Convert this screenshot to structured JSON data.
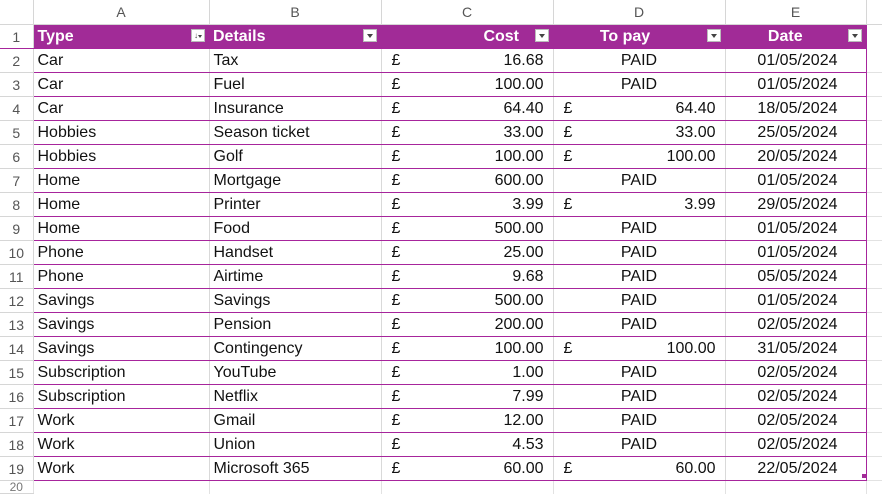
{
  "column_headers": [
    "A",
    "B",
    "C",
    "D",
    "E"
  ],
  "row_numbers": [
    "1",
    "2",
    "3",
    "4",
    "5",
    "6",
    "7",
    "8",
    "9",
    "10",
    "11",
    "12",
    "13",
    "14",
    "15",
    "16",
    "17",
    "18",
    "19",
    "20"
  ],
  "table_headers": {
    "type": "Type",
    "details": "Details",
    "cost": "Cost",
    "to_pay": "To pay",
    "date": "Date"
  },
  "currency_symbol": "£",
  "rows": [
    {
      "type": "Car",
      "details": "Tax",
      "cost": "16.68",
      "to_pay": "PAID",
      "to_pay_currency": "",
      "date": "01/05/2024"
    },
    {
      "type": "Car",
      "details": "Fuel",
      "cost": "100.00",
      "to_pay": "PAID",
      "to_pay_currency": "",
      "date": "01/05/2024"
    },
    {
      "type": "Car",
      "details": "Insurance",
      "cost": "64.40",
      "to_pay": "64.40",
      "to_pay_currency": "£",
      "date": "18/05/2024"
    },
    {
      "type": "Hobbies",
      "details": "Season ticket",
      "cost": "33.00",
      "to_pay": "33.00",
      "to_pay_currency": "£",
      "date": "25/05/2024"
    },
    {
      "type": "Hobbies",
      "details": "Golf",
      "cost": "100.00",
      "to_pay": "100.00",
      "to_pay_currency": "£",
      "date": "20/05/2024"
    },
    {
      "type": "Home",
      "details": "Mortgage",
      "cost": "600.00",
      "to_pay": "PAID",
      "to_pay_currency": "",
      "date": "01/05/2024"
    },
    {
      "type": "Home",
      "details": "Printer",
      "cost": "3.99",
      "to_pay": "3.99",
      "to_pay_currency": "£",
      "date": "29/05/2024"
    },
    {
      "type": "Home",
      "details": "Food",
      "cost": "500.00",
      "to_pay": "PAID",
      "to_pay_currency": "",
      "date": "01/05/2024"
    },
    {
      "type": "Phone",
      "details": "Handset",
      "cost": "25.00",
      "to_pay": "PAID",
      "to_pay_currency": "",
      "date": "01/05/2024"
    },
    {
      "type": "Phone",
      "details": "Airtime",
      "cost": "9.68",
      "to_pay": "PAID",
      "to_pay_currency": "",
      "date": "05/05/2024"
    },
    {
      "type": "Savings",
      "details": "Savings",
      "cost": "500.00",
      "to_pay": "PAID",
      "to_pay_currency": "",
      "date": "01/05/2024"
    },
    {
      "type": "Savings",
      "details": "Pension",
      "cost": "200.00",
      "to_pay": "PAID",
      "to_pay_currency": "",
      "date": "02/05/2024"
    },
    {
      "type": "Savings",
      "details": "Contingency",
      "cost": "100.00",
      "to_pay": "100.00",
      "to_pay_currency": "£",
      "date": "31/05/2024"
    },
    {
      "type": "Subscription",
      "details": "YouTube",
      "cost": "1.00",
      "to_pay": "PAID",
      "to_pay_currency": "",
      "date": "02/05/2024"
    },
    {
      "type": "Subscription",
      "details": "Netflix",
      "cost": "7.99",
      "to_pay": "PAID",
      "to_pay_currency": "",
      "date": "02/05/2024"
    },
    {
      "type": "Work",
      "details": "Gmail",
      "cost": "12.00",
      "to_pay": "PAID",
      "to_pay_currency": "",
      "date": "02/05/2024"
    },
    {
      "type": "Work",
      "details": "Union",
      "cost": "4.53",
      "to_pay": "PAID",
      "to_pay_currency": "",
      "date": "02/05/2024"
    },
    {
      "type": "Work",
      "details": "Microsoft 365",
      "cost": "60.00",
      "to_pay": "60.00",
      "to_pay_currency": "£",
      "date": "22/05/2024"
    }
  ],
  "colors": {
    "table_header_bg": "#a12b97",
    "table_border": "#a7259c",
    "header_text": "#ffffff"
  },
  "icons": {
    "type_filter": "sort-filter-dropdown-icon",
    "other_filters": "filter-dropdown-icon"
  }
}
